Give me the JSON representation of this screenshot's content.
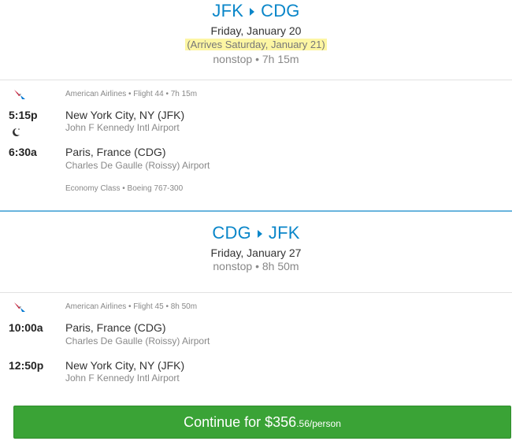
{
  "outbound": {
    "origin": "JFK",
    "destination": "CDG",
    "date": "Friday, January 20",
    "arrives_note": "(Arrives Saturday, January 21)",
    "summary": "nonstop • 7h 15m",
    "airline_line": "American Airlines • Flight 44 • 7h 15m",
    "depart_time": "5:15p",
    "depart_city": "New York City, NY (JFK)",
    "depart_airport": "John F Kennedy Intl Airport",
    "arrive_time": "6:30a",
    "arrive_city": "Paris, France (CDG)",
    "arrive_airport": "Charles De Gaulle (Roissy) Airport",
    "cabin": "Economy Class • Boeing 767-300"
  },
  "return": {
    "origin": "CDG",
    "destination": "JFK",
    "date": "Friday, January 27",
    "summary": "nonstop • 8h 50m",
    "airline_line": "American Airlines • Flight 45 • 8h 50m",
    "depart_time": "10:00a",
    "depart_city": "Paris, France (CDG)",
    "depart_airport": "Charles De Gaulle (Roissy) Airport",
    "arrive_time": "12:50p",
    "arrive_city": "New York City, NY (JFK)",
    "arrive_airport": "John F Kennedy Intl Airport"
  },
  "cta": {
    "label": "Continue for",
    "price": "$356",
    "cents": ".56",
    "per": "/person"
  },
  "icons": {
    "airline": "american-airlines-logo-icon",
    "overnight": "moon-icon",
    "arrow": "route-arrow-icon"
  },
  "colors": {
    "accent": "#0a86c9",
    "cta": "#3aa336",
    "highlight": "#fdf6a3"
  }
}
